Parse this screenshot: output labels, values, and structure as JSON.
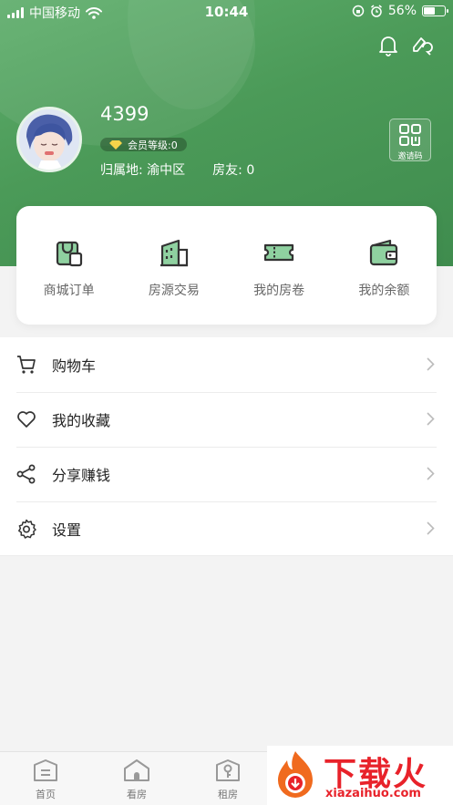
{
  "status_bar": {
    "carrier": "中国移动",
    "time": "10:44",
    "battery": "56%",
    "battery_level": 0.56
  },
  "profile": {
    "username": "4399",
    "member_level": "会员等级:0",
    "location": "归属地: 渝中区",
    "friends": "房友: 0",
    "invite_code_label": "邀请码"
  },
  "quick_actions": [
    {
      "label": "商城订单",
      "icon": "shopping-bag-icon"
    },
    {
      "label": "房源交易",
      "icon": "building-icon"
    },
    {
      "label": "我的房卷",
      "icon": "ticket-icon"
    },
    {
      "label": "我的余额",
      "icon": "wallet-icon"
    }
  ],
  "menu": [
    {
      "label": "购物车",
      "icon": "cart-icon"
    },
    {
      "label": "我的收藏",
      "icon": "heart-icon"
    },
    {
      "label": "分享赚钱",
      "icon": "share-icon"
    },
    {
      "label": "设置",
      "icon": "gear-icon"
    }
  ],
  "tabbar": [
    {
      "label": "首页",
      "icon": "home-icon"
    },
    {
      "label": "看房",
      "icon": "house-icon"
    },
    {
      "label": "租房",
      "icon": "key-icon"
    }
  ],
  "watermark": {
    "brand": "下载火",
    "domain": "xiazaihuo.com"
  },
  "colors": {
    "primary_green": "#4b9a58",
    "icon_green": "#8fd1a0",
    "watermark_red": "#e8222a"
  }
}
